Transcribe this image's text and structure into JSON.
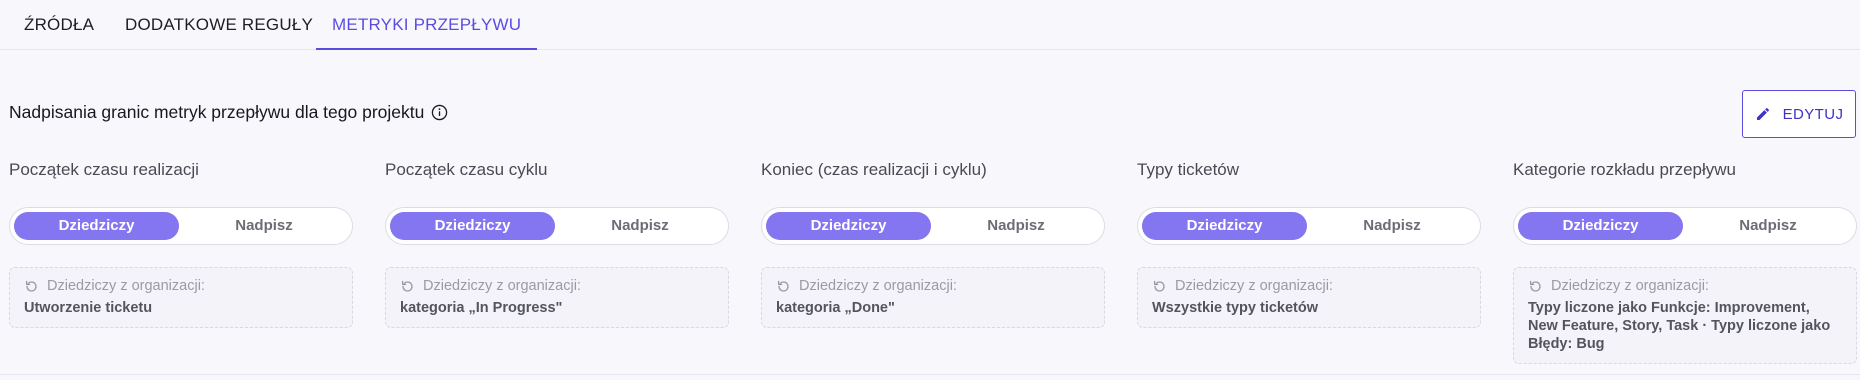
{
  "tabs": [
    {
      "label": "ŹRÓDŁA",
      "active": false
    },
    {
      "label": "DODATKOWE REGUŁY",
      "active": false
    },
    {
      "label": "METRYKI PRZEPŁYWU",
      "active": true
    }
  ],
  "section": {
    "heading": "Nadpisania granic metryk przepływu dla tego projektu",
    "edit_label": "EDYTUJ"
  },
  "columns": [
    {
      "title": "Początek czasu realizacji",
      "inherit_label": "Dziedziczy",
      "override_label": "Nadpisz",
      "inherited_from": "Dziedziczy z organizacji:",
      "inherited_value": "Utworzenie ticketu"
    },
    {
      "title": "Początek czasu cyklu",
      "inherit_label": "Dziedziczy",
      "override_label": "Nadpisz",
      "inherited_from": "Dziedziczy z organizacji:",
      "inherited_value": "kategoria „In Progress\""
    },
    {
      "title": "Koniec (czas realizacji i cyklu)",
      "inherit_label": "Dziedziczy",
      "override_label": "Nadpisz",
      "inherited_from": "Dziedziczy z organizacji:",
      "inherited_value": "kategoria „Done\""
    },
    {
      "title": "Typy ticketów",
      "inherit_label": "Dziedziczy",
      "override_label": "Nadpisz",
      "inherited_from": "Dziedziczy z organizacji:",
      "inherited_value": "Wszystkie typy ticketów"
    },
    {
      "title": "Kategorie rozkładu przepływu",
      "inherit_label": "Dziedziczy",
      "override_label": "Nadpisz",
      "inherited_from": "Dziedziczy z organizacji:",
      "inherited_value": "Typy liczone jako Funkcje: Improvement, New Feature, Story, Task · Typy liczone jako Błędy: Bug"
    }
  ],
  "colors": {
    "accent": "#5b4ce0",
    "toggle_active": "#8475f0",
    "background": "#f8f8fc"
  },
  "icons": [
    "info-icon",
    "pencil-icon",
    "reset-icon"
  ]
}
